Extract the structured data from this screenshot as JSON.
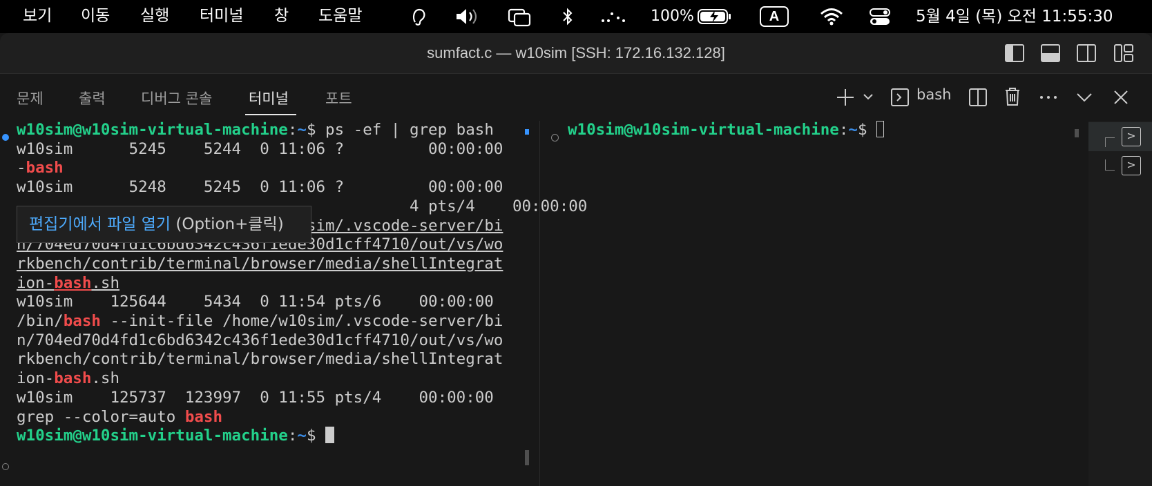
{
  "menubar": {
    "items": [
      "보기",
      "이동",
      "실행",
      "터미널",
      "창",
      "도움말"
    ],
    "battery": "100%",
    "input_source": "A",
    "datetime": "5월 4일 (목) 오전 11:55:30",
    "icons": [
      "hearing-icon",
      "volume-icon",
      "screen-mirroring-icon",
      "bluetooth-icon",
      "dots-icon",
      "battery-charging-icon",
      "input-source-icon",
      "wifi-icon",
      "control-center-icon"
    ]
  },
  "window": {
    "title": "sumfact.c — w10sim [SSH: 172.16.132.128]",
    "layout_icons": [
      "toggle-primary-sidebar-icon",
      "toggle-panel-icon",
      "toggle-secondary-sidebar-icon",
      "customize-layout-icon"
    ]
  },
  "panel": {
    "tabs": [
      "문제",
      "출력",
      "디버그 콘솔",
      "터미널",
      "포트"
    ],
    "active_tab": "터미널",
    "terminal_name": "bash",
    "actions": [
      "new-terminal-icon",
      "launch-profile-chevron-icon",
      "terminal-icon",
      "split-terminal-icon",
      "trash-icon",
      "more-icon",
      "maximize-panel-chevron-icon",
      "close-panel-icon"
    ]
  },
  "terminal_left": {
    "prompt_user": "w10sim@w10sim-virtual-machine",
    "prompt_sep": ":",
    "prompt_path": "~",
    "prompt_dollar": "$",
    "command": " ps -ef | grep bash",
    "row1": "w10sim      5245    5244  0 11:06 ?         00:00:00",
    "row1b_dash": "-",
    "row2": "w10sim      5248    5245  0 11:06 ?         00:00:00",
    "row3_tail": "4 pts/4    00:00:00",
    "path1": "/bin/",
    "opt": " --init-file ",
    "link_a": "/home/w10sim/.vscode-server/bi",
    "link_b": "n/704ed70d4fd1c6bd6342c436f1ede30d1cff4710/out/vs/wo",
    "link_c": "rkbench/contrib/terminal/browser/media/shellIntegrat",
    "link_d": "ion-",
    "link_ext": ".sh",
    "row4": "w10sim    125644    5434  0 11:54 pts/6    00:00:00",
    "path2_a": "/home/w10sim/.vscode-server/bi",
    "path2_b": "n/704ed70d4fd1c6bd6342c436f1ede30d1cff4710/out/vs/wo",
    "path2_c": "rkbench/contrib/terminal/browser/media/shellIntegrat",
    "path2_d": "ion-",
    "ext2": ".sh",
    "row5": "w10sim    125737  123997  0 11:55 pts/4    00:00:00",
    "grep_cmd": "grep --color=auto ",
    "match": "bash"
  },
  "terminal_right": {
    "prompt_user": "w10sim@w10sim-virtual-machine",
    "prompt_sep": ":",
    "prompt_path": "~",
    "prompt_dollar": "$"
  },
  "tooltip": {
    "link": "편집기에서 파일 열기",
    "hint": " (Option+클릭)"
  },
  "colors": {
    "user": "#23d18b",
    "path": "#3b8eea",
    "match": "#f14c4c",
    "link": "#4daafc",
    "bg": "#181818"
  }
}
